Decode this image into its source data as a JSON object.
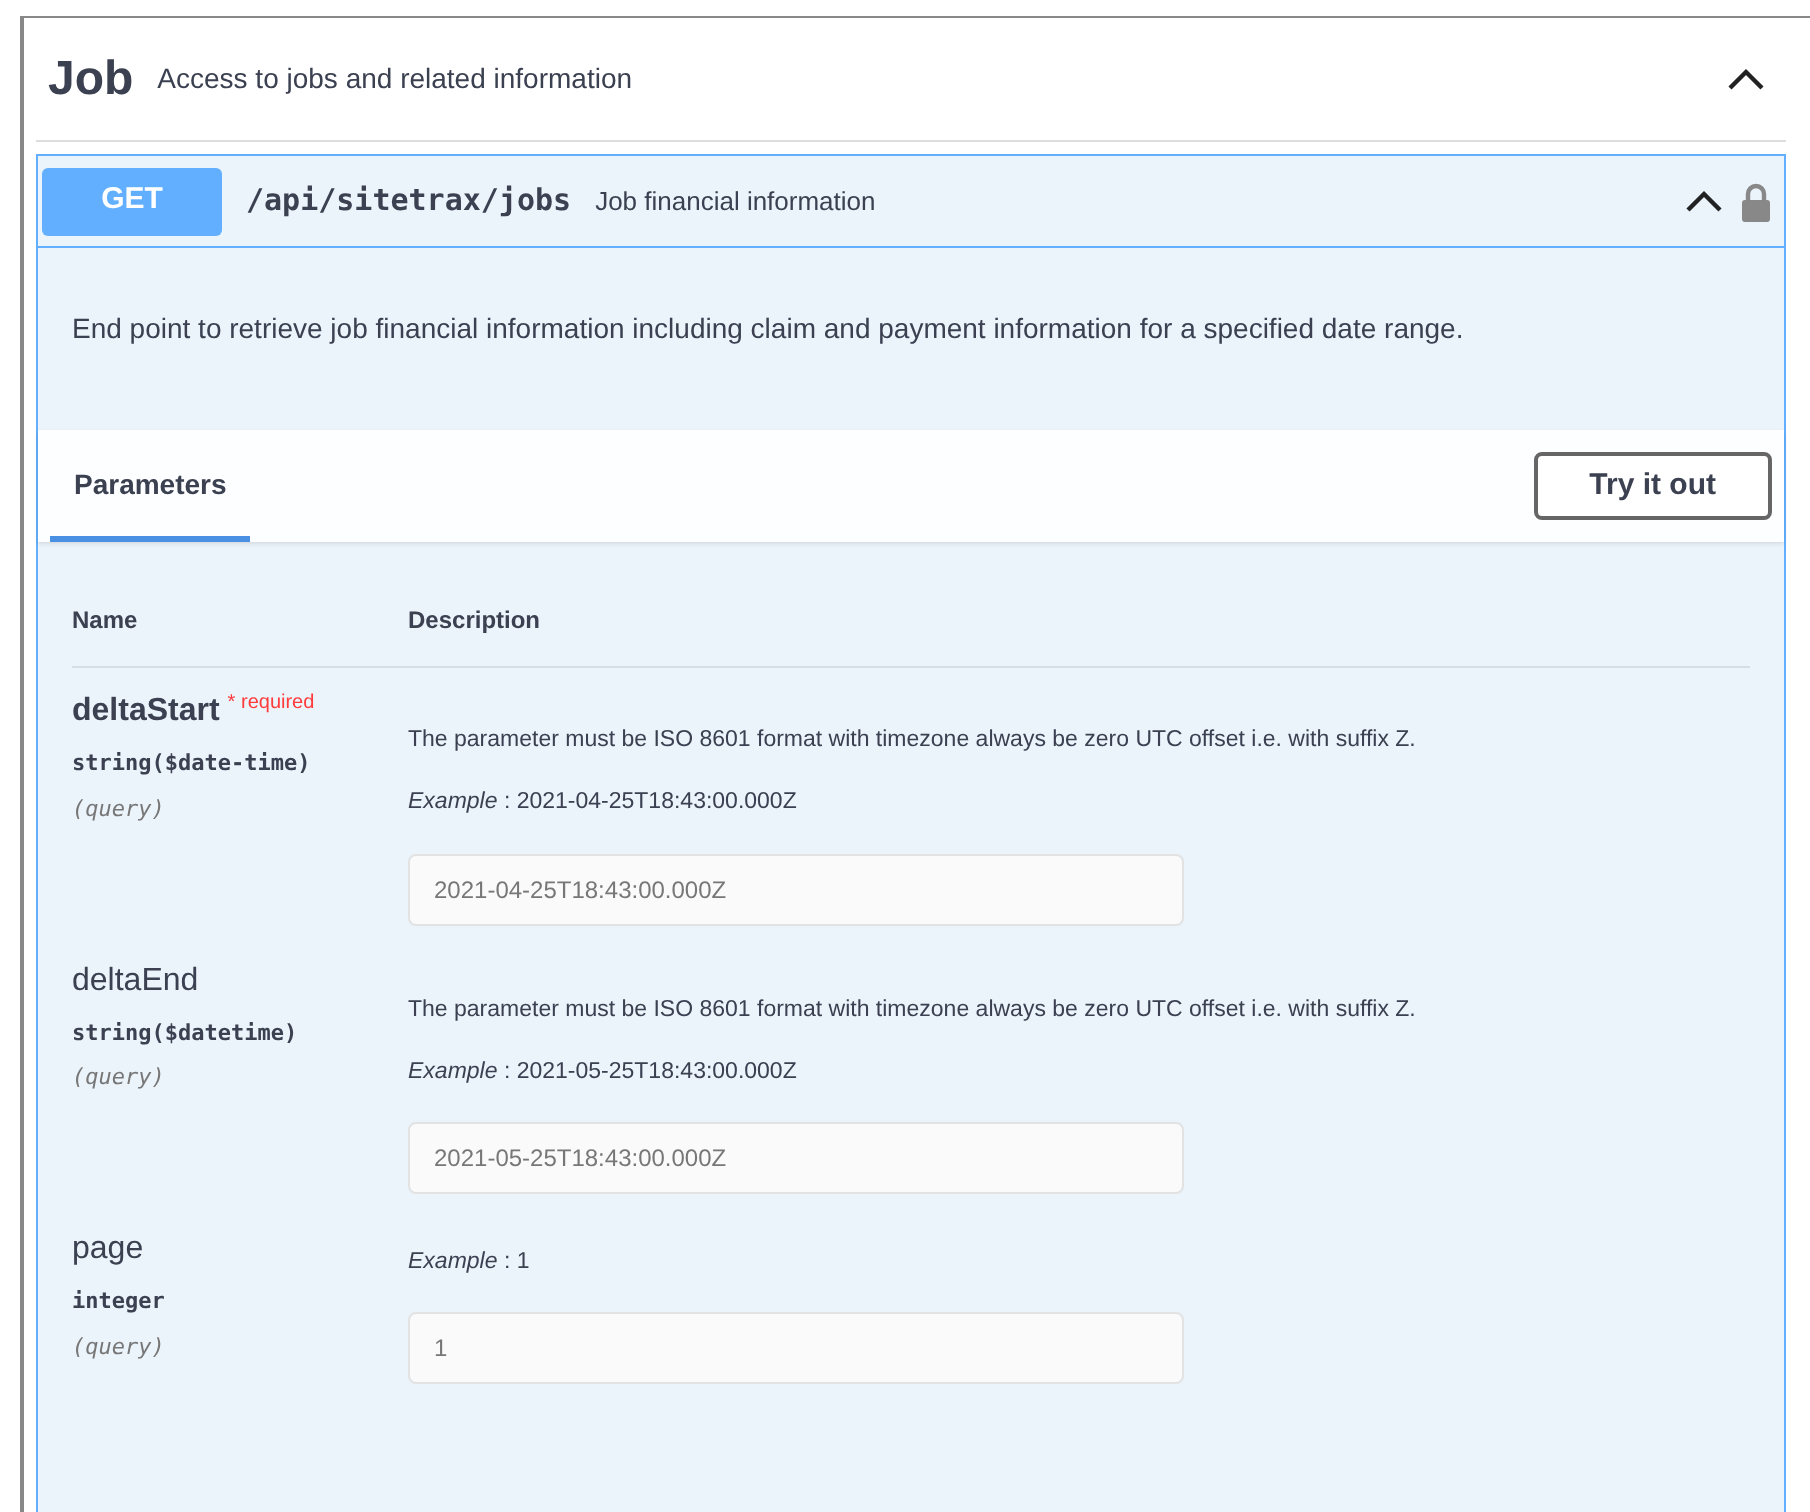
{
  "tag": {
    "name": "Job",
    "description": "Access to jobs and related information",
    "expanded": true
  },
  "operation": {
    "method": "GET",
    "path": "/api/sitetrax/jobs",
    "summary": "Job financial information",
    "expanded": true,
    "locked": true,
    "description": "End point to retrieve job financial information including claim and payment information for a specified date range.",
    "tabs": [
      {
        "label": "Parameters",
        "selected": true
      }
    ],
    "try_button": "Try it out",
    "columns": [
      "Name",
      "Description"
    ],
    "parameters": [
      {
        "name": "deltaStart",
        "required": true,
        "required_mark": "*",
        "required_label": "required",
        "type": "string($date-time)",
        "location": "(query)",
        "description": "The parameter must be ISO 8601 format with timezone always be zero UTC offset i.e. with suffix Z.",
        "example": "*Example* : 2021-04-25T18:43:00.000Z",
        "placeholder": "2021-04-25T18:43:00.000Z"
      },
      {
        "name": "deltaEnd",
        "required": false,
        "type": "string($datetime)",
        "location": "(query)",
        "description": "The parameter must be ISO 8601 format with timezone always be zero UTC offset i.e. with suffix Z.",
        "example": "*Example* : 2021-05-25T18:43:00.000Z",
        "placeholder": "2021-05-25T18:43:00.000Z"
      },
      {
        "name": "page",
        "required": false,
        "type": "integer",
        "location": "(query)",
        "example": "*Example* : 1",
        "placeholder": "1"
      }
    ]
  }
}
